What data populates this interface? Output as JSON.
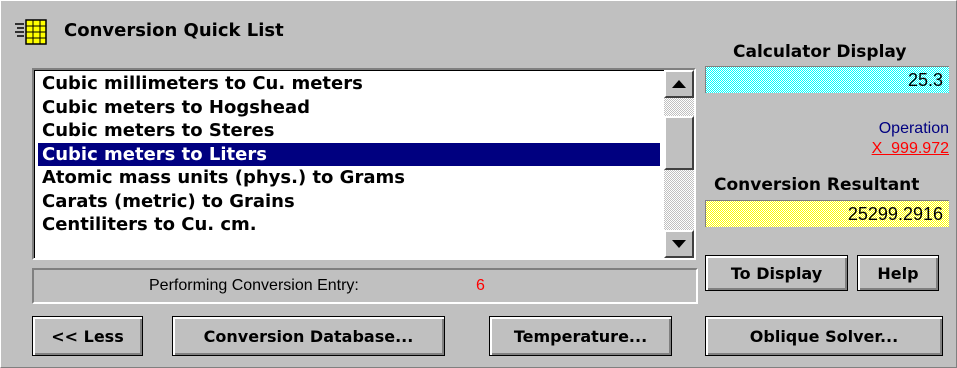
{
  "title": "Conversion Quick List",
  "list_items": [
    "Cubic millimeters to Cu. meters",
    "Cubic meters to Hogshead",
    "Cubic meters to Steres",
    "Cubic meters to Liters",
    "Atomic mass units (phys.) to Grams",
    "Carats (metric) to Grains",
    "Centiliters to Cu. cm."
  ],
  "selected_item": "Cubic meters to Liters",
  "status": {
    "label": "Performing Conversion Entry:",
    "value": "6"
  },
  "calculator": {
    "label": "Calculator Display",
    "value": "25.3"
  },
  "operation": {
    "label": "Operation",
    "value": "X  999.972"
  },
  "conversion": {
    "label": "Conversion Resultant",
    "value": "25299.2916"
  },
  "buttons": {
    "to_display": "To Display",
    "help": "Help",
    "less": "<< Less",
    "database": "Conversion Database...",
    "temperature": "Temperature...",
    "oblique": "Oblique Solver..."
  },
  "colors": {
    "selection": "#000080",
    "calc_display": "#00ffff",
    "conversion_display": "#ffff00",
    "status_value": "#ff0000",
    "operation_label": "#000080",
    "operation_value": "#ff0000"
  },
  "icons": {
    "title": "notepad-icon"
  }
}
